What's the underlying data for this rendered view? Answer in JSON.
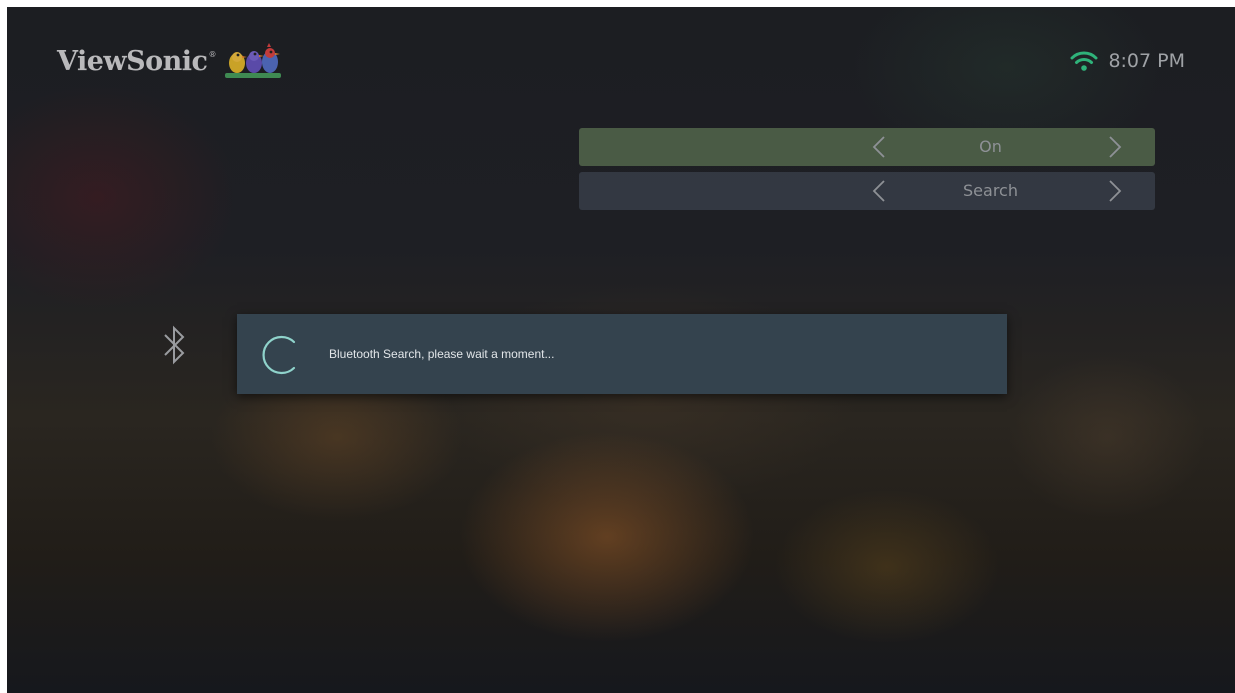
{
  "header": {
    "logo_text": "ViewSonic",
    "logo_reg_mark": "®",
    "logo_icon": "viewsonic-birds-icon",
    "wifi_icon": "wifi-icon",
    "time": "8:07 PM"
  },
  "settings": {
    "rows": [
      {
        "name": "bluetooth-power",
        "value": "On",
        "selected": true
      },
      {
        "name": "bluetooth-search",
        "value": "Search",
        "selected": false
      }
    ]
  },
  "side": {
    "icon": "bluetooth-icon"
  },
  "dialog": {
    "spinner_icon": "loading-spinner-icon",
    "message": "Bluetooth Search, please wait a moment..."
  },
  "colors": {
    "selected_row": "#4a5b45",
    "row": "#3c424e",
    "dialog_bg": "#34434e",
    "spinner": "#8fd3cb",
    "wifi": "#2fb37a"
  }
}
